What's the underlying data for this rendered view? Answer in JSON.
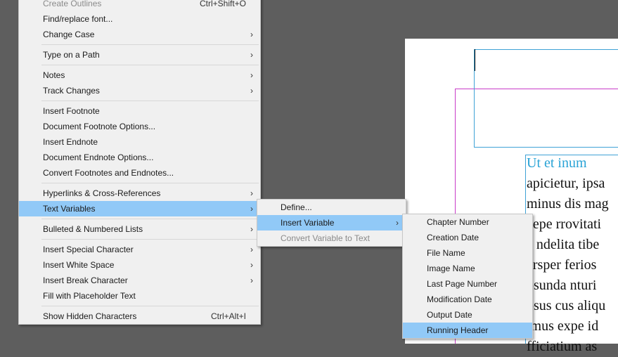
{
  "document": {
    "heading": "Ut et inum",
    "lines": [
      "apicietur, ipsa",
      "minus dis mag",
      "aepe rrovitati",
      "a ndelita tibe",
      "ersper ferios",
      "osunda nturi",
      "osus cus aliqu",
      "imus expe id",
      "fficiatium as"
    ]
  },
  "main_menu": {
    "create_outlines": "Create Outlines",
    "create_outlines_shortcut": "Ctrl+Shift+O",
    "find_replace_font": "Find/replace font...",
    "change_case": "Change Case",
    "type_on_path": "Type on a Path",
    "notes": "Notes",
    "track_changes": "Track Changes",
    "insert_footnote": "Insert Footnote",
    "doc_footnote_options": "Document Footnote Options...",
    "insert_endnote": "Insert Endnote",
    "doc_endnote_options": "Document Endnote Options...",
    "convert_footnotes": "Convert Footnotes and Endnotes...",
    "hyperlinks": "Hyperlinks & Cross-References",
    "text_variables": "Text Variables",
    "bulleted_lists": "Bulleted & Numbered Lists",
    "insert_special_char": "Insert Special Character",
    "insert_white_space": "Insert White Space",
    "insert_break_char": "Insert Break Character",
    "fill_placeholder": "Fill with Placeholder Text",
    "show_hidden": "Show Hidden Characters",
    "show_hidden_shortcut": "Ctrl+Alt+I"
  },
  "text_variables_menu": {
    "define": "Define...",
    "insert_variable": "Insert Variable",
    "convert_variable": "Convert Variable to Text"
  },
  "insert_variable_menu": {
    "chapter_number": "Chapter Number",
    "creation_date": "Creation Date",
    "file_name": "File Name",
    "image_name": "Image Name",
    "last_page_number": "Last Page Number",
    "modification_date": "Modification Date",
    "output_date": "Output Date",
    "running_header": "Running Header"
  },
  "submenu_arrow": "›"
}
